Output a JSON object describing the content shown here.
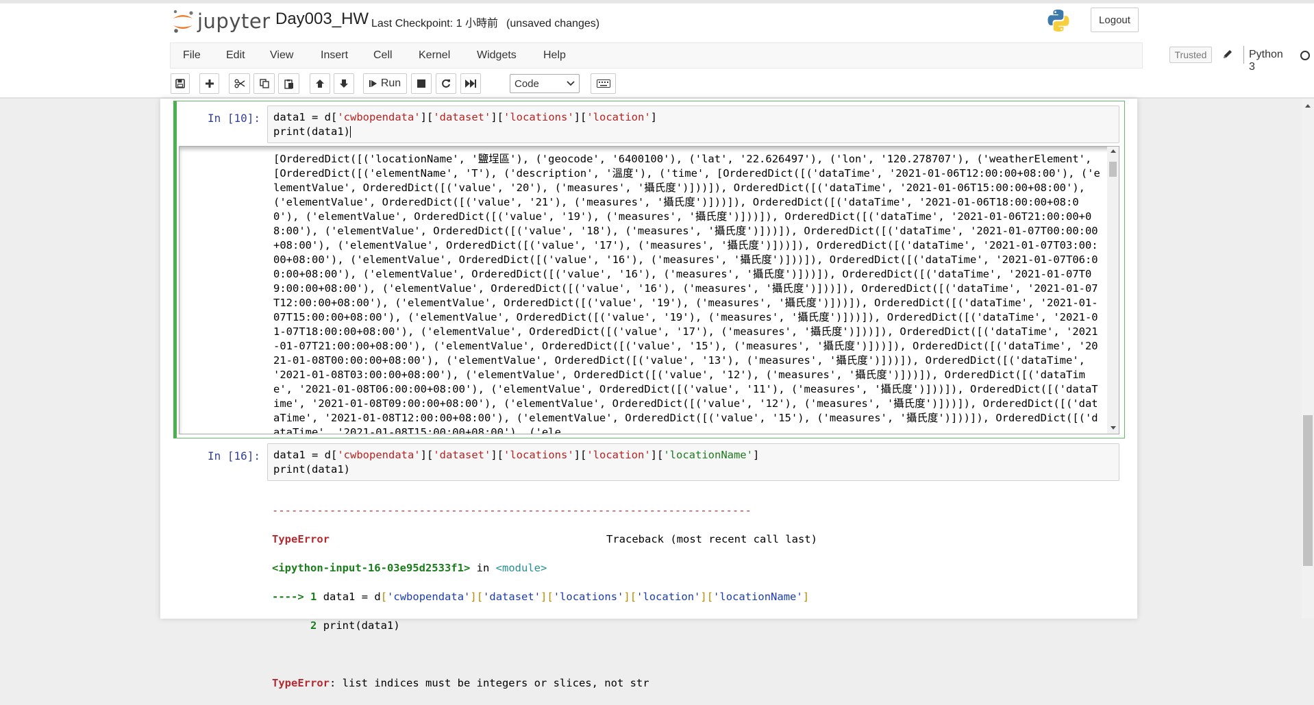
{
  "header": {
    "logo_text": "jupyter",
    "notebook_name": "Day003_HW",
    "checkpoint": "Last Checkpoint: 1 小時前",
    "unsaved": "(unsaved changes)",
    "logout_label": "Logout"
  },
  "menu": {
    "items": [
      "File",
      "Edit",
      "View",
      "Insert",
      "Cell",
      "Kernel",
      "Widgets",
      "Help"
    ],
    "trusted_label": "Trusted",
    "kernel_name": "Python 3"
  },
  "toolbar": {
    "run_label": "Run",
    "cell_type": "Code"
  },
  "cells": [
    {
      "prompt": "In [10]:",
      "code_line1_pre": "data1 = d[",
      "code_line1_keys": [
        "'cwbopendata'",
        "'dataset'",
        "'locations'",
        "'location'"
      ],
      "code_line2": "print(data1)",
      "output": "[OrderedDict([('locationName', '鹽埕區'), ('geocode', '6400100'), ('lat', '22.626497'), ('lon', '120.278707'), ('weatherElement', [OrderedDict([('elementName', 'T'), ('description', '溫度'), ('time', [OrderedDict([('dataTime', '2021-01-06T12:00:00+08:00'), ('elementValue', OrderedDict([('value', '20'), ('measures', '攝氏度')]))]), OrderedDict([('dataTime', '2021-01-06T15:00:00+08:00'), ('elementValue', OrderedDict([('value', '21'), ('measures', '攝氏度')]))]), OrderedDict([('dataTime', '2021-01-06T18:00:00+08:00'), ('elementValue', OrderedDict([('value', '19'), ('measures', '攝氏度')]))]), OrderedDict([('dataTime', '2021-01-06T21:00:00+08:00'), ('elementValue', OrderedDict([('value', '18'), ('measures', '攝氏度')]))]), OrderedDict([('dataTime', '2021-01-07T00:00:00+08:00'), ('elementValue', OrderedDict([('value', '17'), ('measures', '攝氏度')]))]), OrderedDict([('dataTime', '2021-01-07T03:00:00+08:00'), ('elementValue', OrderedDict([('value', '16'), ('measures', '攝氏度')]))]), OrderedDict([('dataTime', '2021-01-07T06:00:00+08:00'), ('elementValue', OrderedDict([('value', '16'), ('measures', '攝氏度')]))]), OrderedDict([('dataTime', '2021-01-07T09:00:00+08:00'), ('elementValue', OrderedDict([('value', '16'), ('measures', '攝氏度')]))]), OrderedDict([('dataTime', '2021-01-07T12:00:00+08:00'), ('elementValue', OrderedDict([('value', '19'), ('measures', '攝氏度')]))]), OrderedDict([('dataTime', '2021-01-07T15:00:00+08:00'), ('elementValue', OrderedDict([('value', '19'), ('measures', '攝氏度')]))]), OrderedDict([('dataTime', '2021-01-07T18:00:00+08:00'), ('elementValue', OrderedDict([('value', '17'), ('measures', '攝氏度')]))]), OrderedDict([('dataTime', '2021-01-07T21:00:00+08:00'), ('elementValue', OrderedDict([('value', '15'), ('measures', '攝氏度')]))]), OrderedDict([('dataTime', '2021-01-08T00:00:00+08:00'), ('elementValue', OrderedDict([('value', '13'), ('measures', '攝氏度')]))]), OrderedDict([('dataTime', '2021-01-08T03:00:00+08:00'), ('elementValue', OrderedDict([('value', '12'), ('measures', '攝氏度')]))]), OrderedDict([('dataTime', '2021-01-08T06:00:00+08:00'), ('elementValue', OrderedDict([('value', '11'), ('measures', '攝氏度')]))]), OrderedDict([('dataTime', '2021-01-08T09:00:00+08:00'), ('elementValue', OrderedDict([('value', '12'), ('measures', '攝氏度')]))]), OrderedDict([('dataTime', '2021-01-08T12:00:00+08:00'), ('elementValue', OrderedDict([('value', '15'), ('measures', '攝氏度')]))]), OrderedDict([('dataTime', '2021-01-08T15:00:00+08:00'), ('ele"
    },
    {
      "prompt": "In [16]:",
      "code_line1_pre": "data1 = d[",
      "code_line1_keys": [
        "'cwbopendata'",
        "'dataset'",
        "'locations'",
        "'location'",
        "'locationName'"
      ],
      "code_line2": "print(data1)"
    }
  ],
  "error": {
    "dashes": "---------------------------------------------------------------------------",
    "type": "TypeError",
    "traceback_label": "Traceback (most recent call last)",
    "input_ref": "<ipython-input-16-03e95d2533f1>",
    "in_word": "in",
    "module": "<module>",
    "arrow": "---->",
    "line1_no": "1",
    "line1_pre": "data1 = d",
    "line2_no": "2",
    "line2_code": "print(data1)",
    "message": "list indices must be integers or slices, not str"
  },
  "colors": {
    "selected_border": "#4caf50",
    "prompt": "#303f9f",
    "string": "#ba2121",
    "error": "#b22b31"
  }
}
